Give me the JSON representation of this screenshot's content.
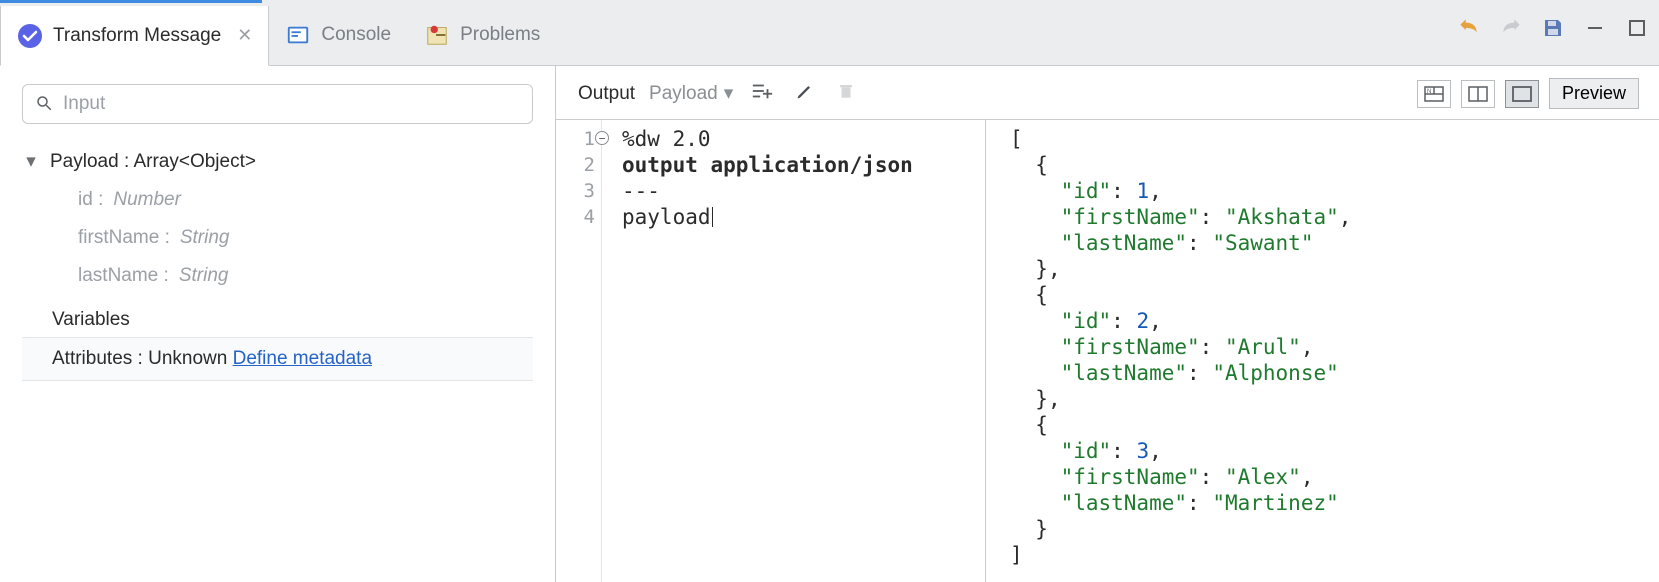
{
  "tabs": {
    "transform": "Transform Message",
    "console": "Console",
    "problems": "Problems"
  },
  "leftPanel": {
    "searchPlaceholder": "Input",
    "payloadRoot": "Payload : Array<Object>",
    "fields": [
      {
        "name": "id",
        "type": "Number"
      },
      {
        "name": "firstName",
        "type": "String"
      },
      {
        "name": "lastName",
        "type": "String"
      }
    ],
    "variablesLabel": "Variables",
    "attributesPrefix": "Attributes : Unknown ",
    "defineMetadata": "Define metadata"
  },
  "outputBar": {
    "label": "Output",
    "selector": "Payload",
    "previewLabel": "Preview"
  },
  "code": {
    "lines": [
      "%dw 2.0",
      "output application/json",
      "---",
      "payload"
    ]
  },
  "previewJson": [
    {
      "id": 1,
      "firstName": "Akshata",
      "lastName": "Sawant"
    },
    {
      "id": 2,
      "firstName": "Arul",
      "lastName": "Alphonse"
    },
    {
      "id": 3,
      "firstName": "Alex",
      "lastName": "Martinez"
    }
  ]
}
